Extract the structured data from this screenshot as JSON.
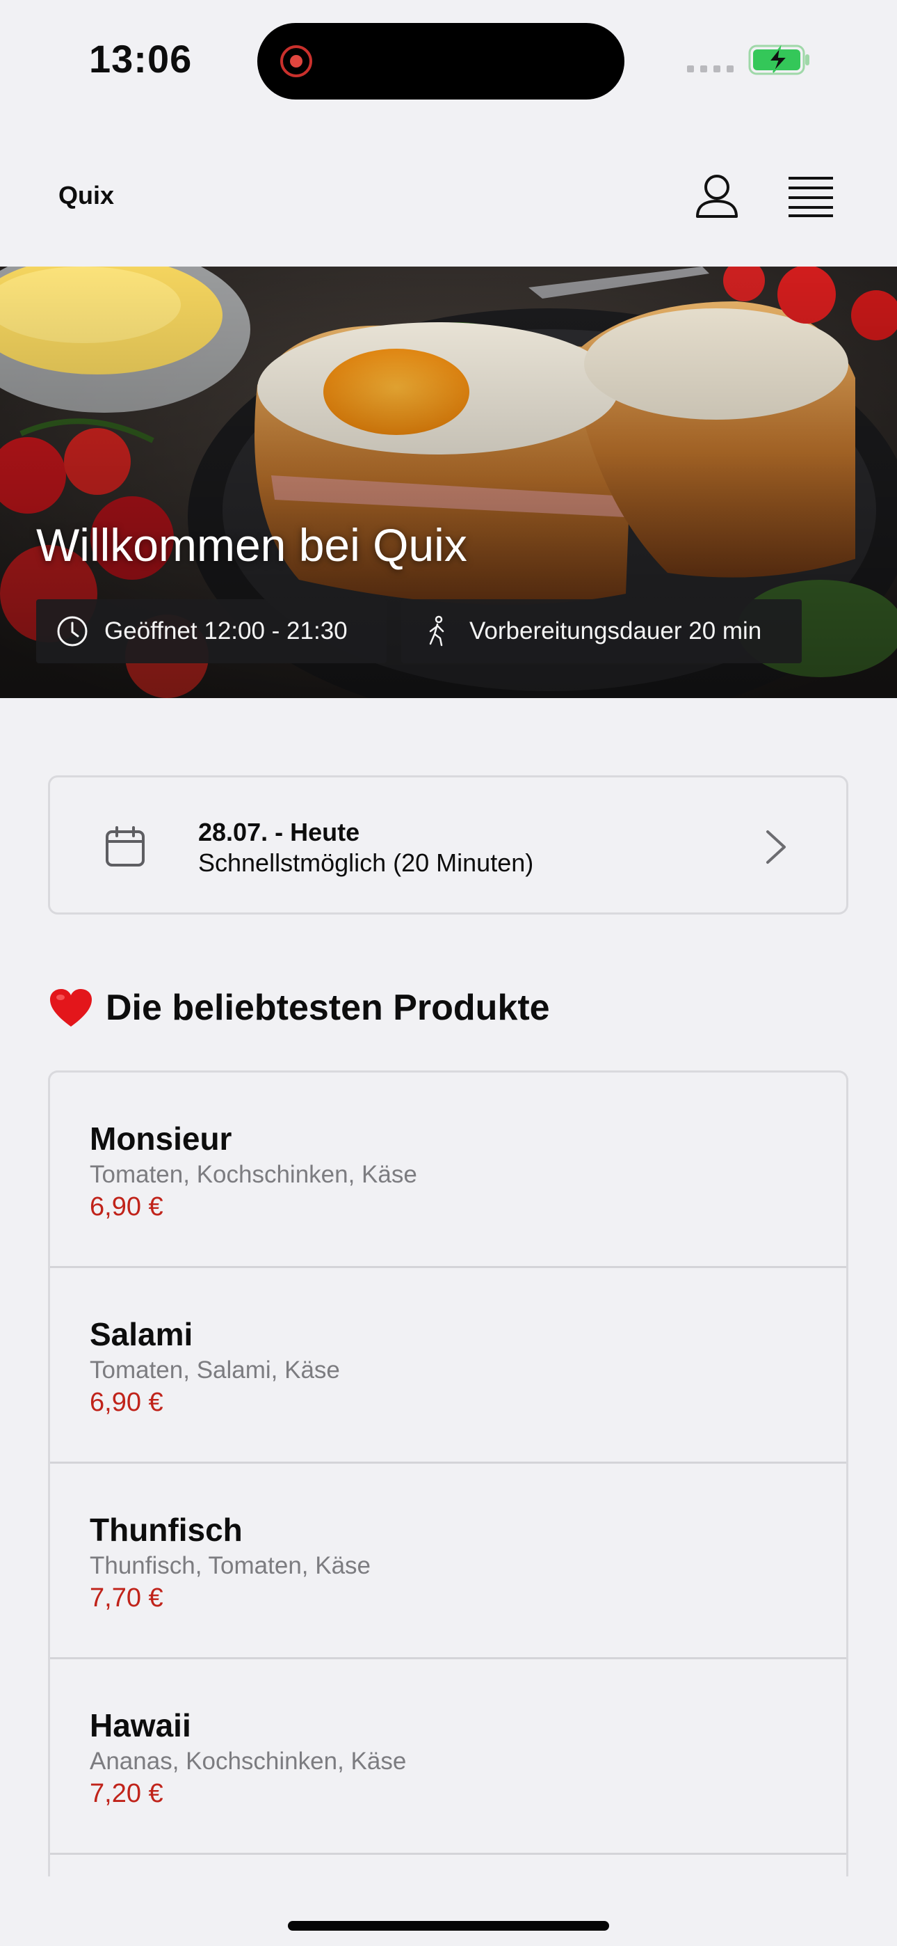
{
  "status_bar": {
    "time": "13:06"
  },
  "header": {
    "brand": "Quix"
  },
  "hero": {
    "title": "Willkommen bei Quix",
    "opening_hours": "Geöffnet 12:00 - 21:30",
    "prep_time": "Vorbereitungsdauer 20 min"
  },
  "date_selector": {
    "line1": "28.07. - Heute",
    "line2": "Schnellstmöglich (20 Minuten)"
  },
  "popular": {
    "title": "Die beliebtesten Produkte",
    "products": [
      {
        "name": "Monsieur",
        "ingredients": "Tomaten, Kochschinken, Käse",
        "price": "6,90 €"
      },
      {
        "name": "Salami",
        "ingredients": "Tomaten, Salami, Käse",
        "price": "6,90 €"
      },
      {
        "name": "Thunfisch",
        "ingredients": "Thunfisch, Tomaten, Käse",
        "price": "7,70 €"
      },
      {
        "name": "Hawaii",
        "ingredients": "Ananas, Kochschinken, Käse",
        "price": "7,20 €"
      }
    ]
  },
  "colors": {
    "accent_price": "#c0231a",
    "background": "#f1f1f4",
    "battery": "#34c759"
  }
}
